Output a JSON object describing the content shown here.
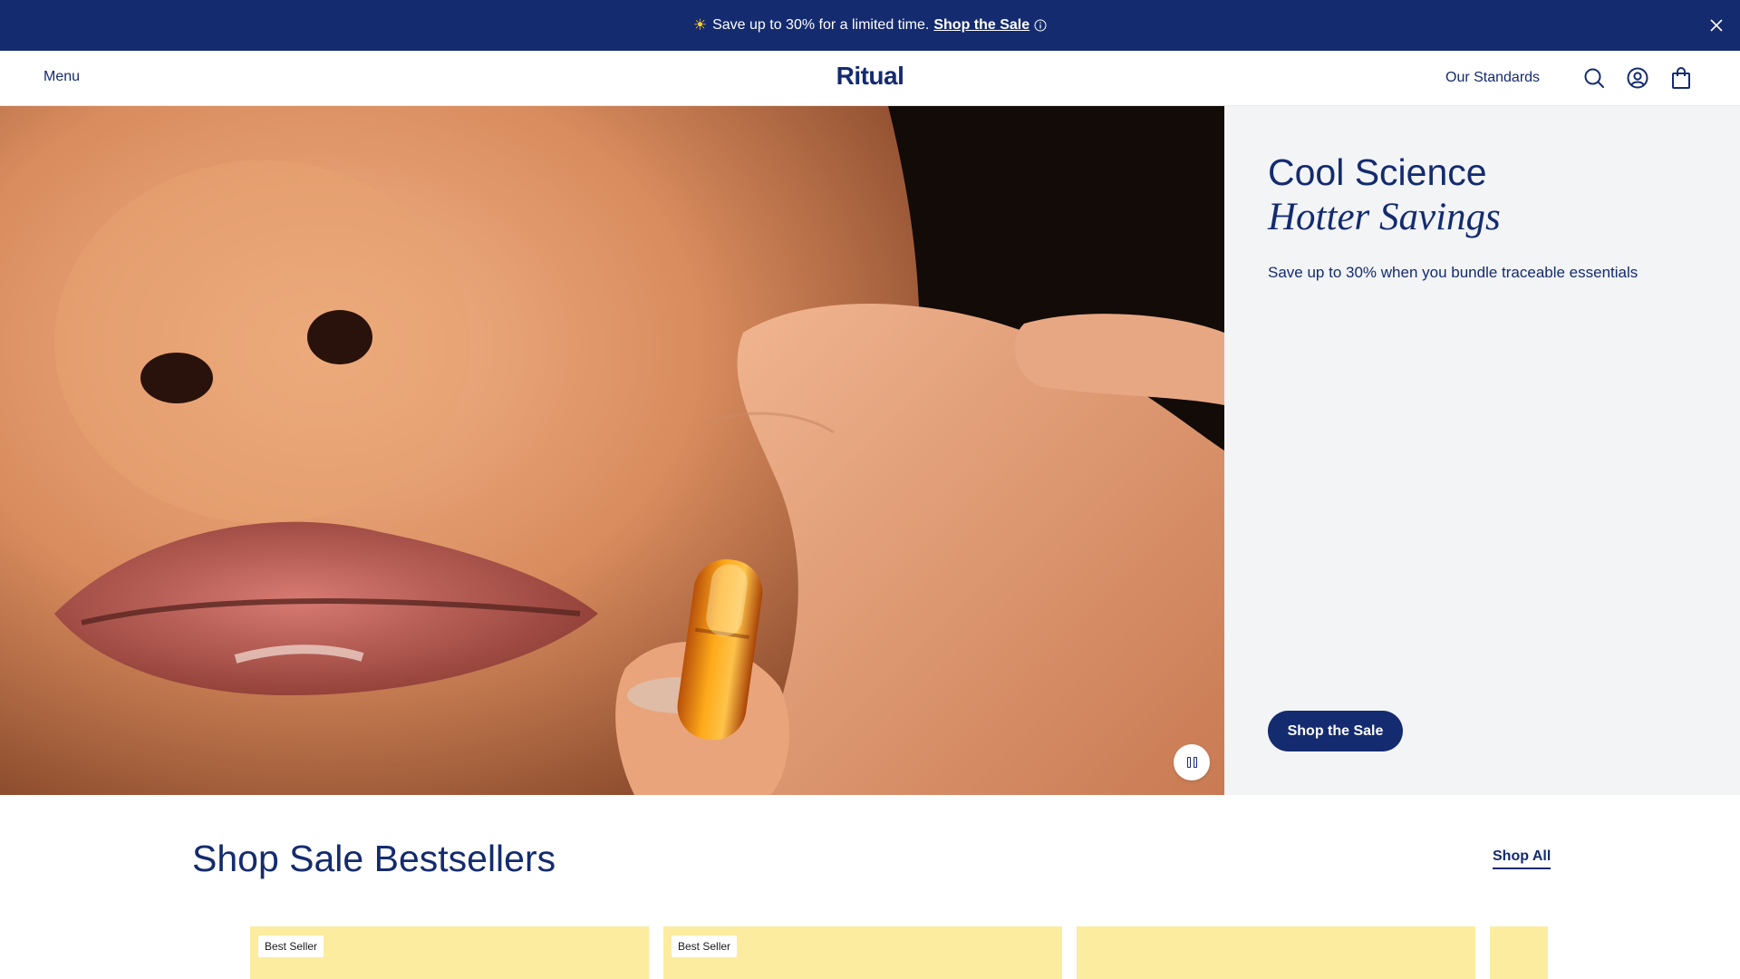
{
  "promo": {
    "icon": "sun-icon",
    "text": "Save up to 30% for a limited time.",
    "link": "Shop the Sale",
    "info_icon": "info-icon",
    "close_icon": "close-icon"
  },
  "header": {
    "menu_label": "Menu",
    "logo": "Ritual",
    "nav_standards": "Our Standards",
    "icons": [
      "search-icon",
      "account-icon",
      "bag-icon"
    ]
  },
  "hero": {
    "title": "Cool Science",
    "title_italic": "Hotter Savings",
    "subtitle": "Save up to 30% when you bundle traceable essentials",
    "cta": "Shop the Sale",
    "pause_icon": "pause-icon"
  },
  "bestsellers": {
    "title": "Shop Sale Bestsellers",
    "shop_all": "Shop All",
    "cards": [
      {
        "badge": "Best Seller"
      },
      {
        "badge": "Best Seller"
      },
      {
        "badge": ""
      },
      {
        "badge": ""
      }
    ]
  },
  "colors": {
    "brand_navy": "#142b6f",
    "panel_bg": "#f2f4f6",
    "card_yellow": "#fbec9f"
  }
}
